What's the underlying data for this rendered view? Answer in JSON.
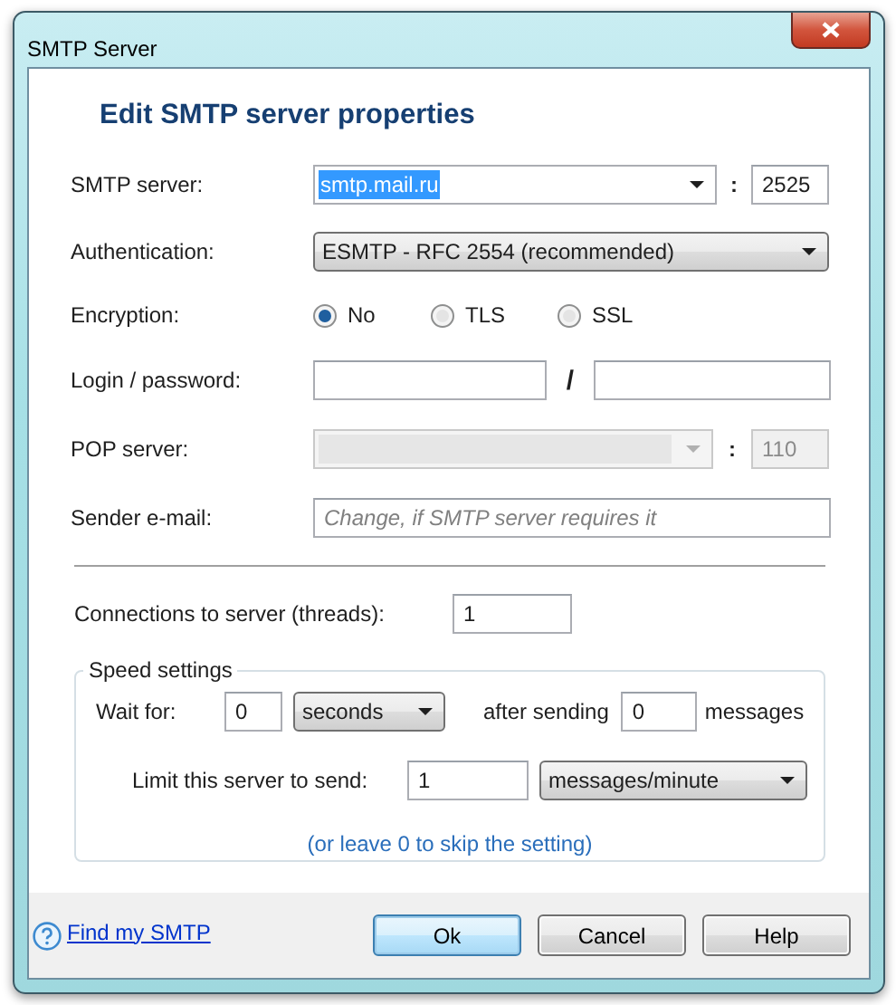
{
  "window": {
    "title": "SMTP Server"
  },
  "heading": "Edit SMTP server properties",
  "smtp_server": {
    "label": "SMTP server:",
    "value": "smtp.mail.ru",
    "highlighted": true,
    "separator": ":",
    "port": "2525"
  },
  "authentication": {
    "label": "Authentication:",
    "value": "ESMTP - RFC 2554 (recommended)"
  },
  "encryption": {
    "label": "Encryption:",
    "options": [
      {
        "label": "No",
        "selected": true
      },
      {
        "label": "TLS",
        "selected": false
      },
      {
        "label": "SSL",
        "selected": false
      }
    ]
  },
  "login": {
    "label": "Login / password:",
    "separator": "/"
  },
  "pop_server": {
    "label": "POP server:",
    "separator": ":",
    "port": "110",
    "disabled": true
  },
  "sender_email": {
    "label": "Sender e-mail:",
    "placeholder": "Change, if SMTP server requires it"
  },
  "connections": {
    "label": "Connections to server (threads):",
    "value": "1"
  },
  "speed_settings": {
    "legend": "Speed settings",
    "wait_label": "Wait for:",
    "wait_value": "0",
    "wait_unit": "seconds",
    "after_label": "after sending",
    "after_value": "0",
    "messages_label": "messages",
    "limit_label": "Limit this server to send:",
    "limit_value": "1",
    "limit_unit": "messages/minute",
    "note": "(or leave 0 to skip the setting)"
  },
  "footer": {
    "link": "Find my SMTP",
    "buttons": [
      {
        "label": "Ok",
        "default": true
      },
      {
        "label": "Cancel",
        "default": false
      },
      {
        "label": "Help",
        "default": false
      }
    ]
  }
}
